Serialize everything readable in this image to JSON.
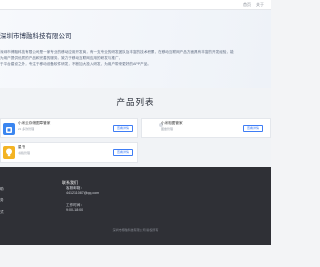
{
  "header": {
    "nav": [
      "首页",
      "关于"
    ]
  },
  "hero": {
    "company_name": "深圳市博融科技有限公司",
    "lines": [
      "深圳市博融科技有限公司是一家专业的移动应用开发商，有一支专业的研发团队及丰富的技术积累，在移动互联网产品方面具有丰富的开发经验，能",
      "为用户提供优质的产品和完善的服务。致力于移动互联网应用的研发与推广，",
      "于平台建设之外，专注于移动设备软件研发，不断加大投入研发，为用户带来更好的APP产品。"
    ]
  },
  "products": {
    "title": "产品列表",
    "items": [
      {
        "name": "小米云存储图章管家",
        "sub": "21 多款管理",
        "button": "查看详情",
        "icon_color": "#3b86f0"
      },
      {
        "name": "小米相图管家",
        "sub": "图章管理",
        "button": "查看详情",
        "icon_color": "#ffffff"
      },
      {
        "name": "星书",
        "sub": "书籍管理",
        "button": "查看详情",
        "icon_color": "#f3b323"
      }
    ]
  },
  "footer": {
    "left_links": [
      "助",
      "务",
      "式"
    ],
    "contact_title": "联系我们",
    "contact_lines": [
      "客服邮箱：",
      "441211087@qq.com",
      "工作时间：",
      "9:00-18:00"
    ],
    "copyright": "深圳市博融科技有限公司 版权所有"
  }
}
